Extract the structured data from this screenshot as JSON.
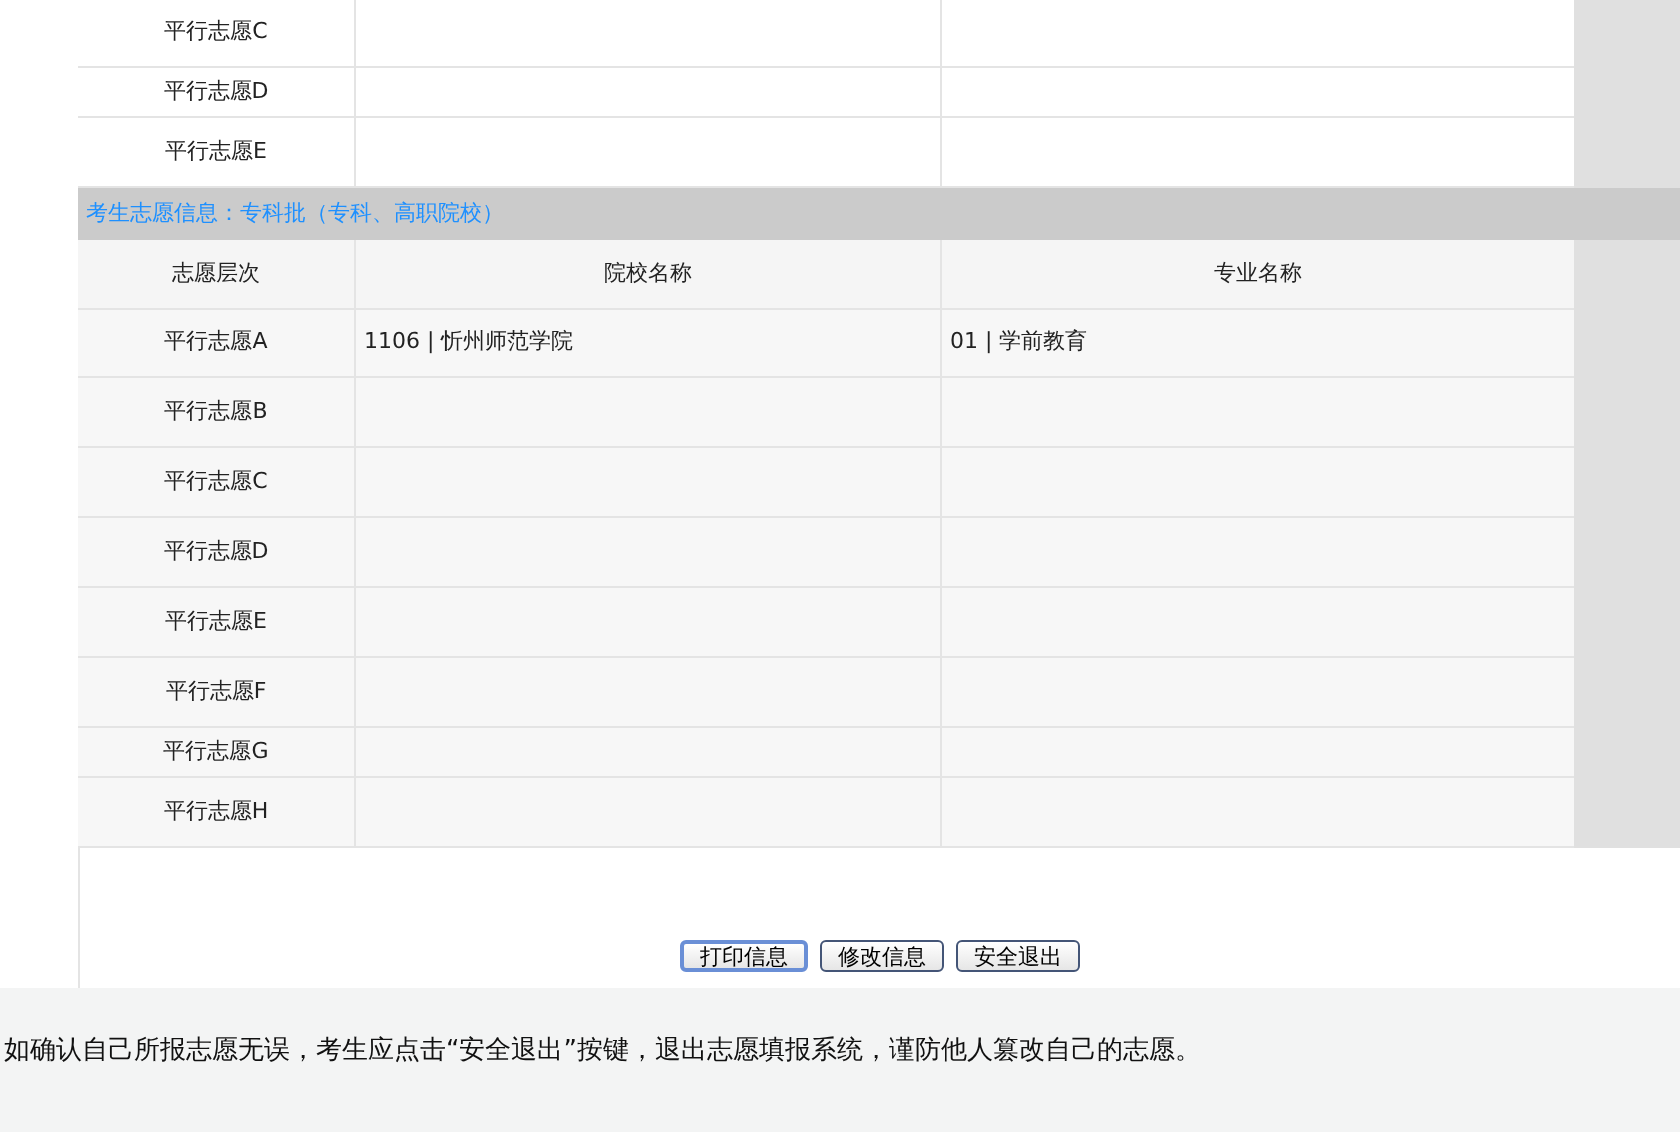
{
  "upper_rows": [
    {
      "level": "平行志愿C",
      "school": "",
      "major": ""
    },
    {
      "level": "平行志愿D",
      "school": "",
      "major": ""
    },
    {
      "level": "平行志愿E",
      "school": "",
      "major": ""
    }
  ],
  "section": {
    "title": "考生志愿信息：专科批（专科、高职院校）",
    "columns": [
      "志愿层次",
      "院校名称",
      "专业名称"
    ],
    "rows": [
      {
        "level": "平行志愿A",
        "school": "1106 | 忻州师范学院",
        "major": "01 | 学前教育"
      },
      {
        "level": "平行志愿B",
        "school": "",
        "major": ""
      },
      {
        "level": "平行志愿C",
        "school": "",
        "major": ""
      },
      {
        "level": "平行志愿D",
        "school": "",
        "major": ""
      },
      {
        "level": "平行志愿E",
        "school": "",
        "major": ""
      },
      {
        "level": "平行志愿F",
        "school": "",
        "major": ""
      },
      {
        "level": "平行志愿G",
        "school": "",
        "major": ""
      },
      {
        "level": "平行志愿H",
        "school": "",
        "major": ""
      }
    ]
  },
  "buttons": [
    {
      "label": "打印信息",
      "focused": true
    },
    {
      "label": "修改信息",
      "focused": false
    },
    {
      "label": "安全退出",
      "focused": false
    }
  ],
  "note": "如确认自己所报志愿无误，考生应点击“安全退出”按键，退出志愿填报系统，谨防他人篡改自己的志愿。"
}
